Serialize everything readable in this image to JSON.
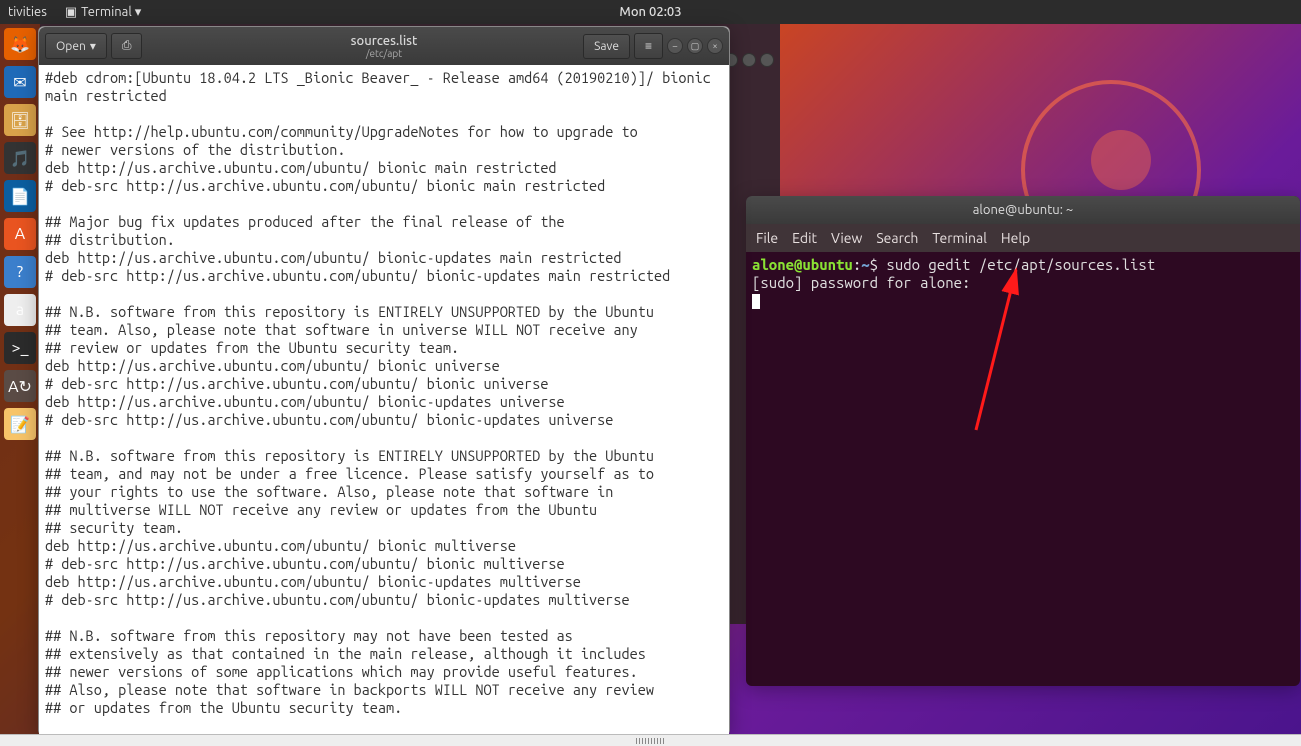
{
  "top_panel": {
    "activities": "tivities",
    "app_menu": "Terminal ▾",
    "clock": "Mon 02:03"
  },
  "launcher": {
    "items": [
      {
        "name": "firefox-icon",
        "bg": "#e66000",
        "glyph": "🦊"
      },
      {
        "name": "thunderbird-icon",
        "bg": "#1f6ab8",
        "glyph": "✉"
      },
      {
        "name": "files-icon",
        "bg": "#d9a24a",
        "glyph": "🗄"
      },
      {
        "name": "rhythmbox-icon",
        "bg": "#333",
        "glyph": "🎵"
      },
      {
        "name": "libreoffice-writer-icon",
        "bg": "#0b5ea0",
        "glyph": "📄"
      },
      {
        "name": "software-icon",
        "bg": "#e95420",
        "glyph": "A"
      },
      {
        "name": "help-icon",
        "bg": "#3b7fcc",
        "glyph": "?"
      },
      {
        "name": "amazon-icon",
        "bg": "#eee",
        "glyph": "a"
      },
      {
        "name": "terminal-icon",
        "bg": "#2b2b2b",
        "glyph": ">_"
      },
      {
        "name": "updater-icon",
        "bg": "#5a4b45",
        "glyph": "A↻"
      },
      {
        "name": "notes-icon",
        "bg": "#f7c469",
        "glyph": "📝"
      }
    ]
  },
  "gedit": {
    "open_label": "Open",
    "save_label": "Save",
    "title": "sources.list",
    "subtitle": "/etc/apt",
    "content": "#deb cdrom:[Ubuntu 18.04.2 LTS _Bionic Beaver_ - Release amd64 (20190210)]/ bionic main restricted\n\n# See http://help.ubuntu.com/community/UpgradeNotes for how to upgrade to\n# newer versions of the distribution.\ndeb http://us.archive.ubuntu.com/ubuntu/ bionic main restricted\n# deb-src http://us.archive.ubuntu.com/ubuntu/ bionic main restricted\n\n## Major bug fix updates produced after the final release of the\n## distribution.\ndeb http://us.archive.ubuntu.com/ubuntu/ bionic-updates main restricted\n# deb-src http://us.archive.ubuntu.com/ubuntu/ bionic-updates main restricted\n\n## N.B. software from this repository is ENTIRELY UNSUPPORTED by the Ubuntu\n## team. Also, please note that software in universe WILL NOT receive any\n## review or updates from the Ubuntu security team.\ndeb http://us.archive.ubuntu.com/ubuntu/ bionic universe\n# deb-src http://us.archive.ubuntu.com/ubuntu/ bionic universe\ndeb http://us.archive.ubuntu.com/ubuntu/ bionic-updates universe\n# deb-src http://us.archive.ubuntu.com/ubuntu/ bionic-updates universe\n\n## N.B. software from this repository is ENTIRELY UNSUPPORTED by the Ubuntu\n## team, and may not be under a free licence. Please satisfy yourself as to\n## your rights to use the software. Also, please note that software in\n## multiverse WILL NOT receive any review or updates from the Ubuntu\n## security team.\ndeb http://us.archive.ubuntu.com/ubuntu/ bionic multiverse\n# deb-src http://us.archive.ubuntu.com/ubuntu/ bionic multiverse\ndeb http://us.archive.ubuntu.com/ubuntu/ bionic-updates multiverse\n# deb-src http://us.archive.ubuntu.com/ubuntu/ bionic-updates multiverse\n\n## N.B. software from this repository may not have been tested as\n## extensively as that contained in the main release, although it includes\n## newer versions of some applications which may provide useful features.\n## Also, please note that software in backports WILL NOT receive any review\n## or updates from the Ubuntu security team."
  },
  "terminal": {
    "title": "alone@ubuntu: ~",
    "menu": {
      "file": "File",
      "edit": "Edit",
      "view": "View",
      "search": "Search",
      "terminal": "Terminal",
      "help": "Help"
    },
    "prompt_user": "alone@ubuntu",
    "prompt_sep": ":",
    "prompt_path": "~",
    "prompt_symbol": "$",
    "command": " sudo gedit /etc/apt/sources.list",
    "line2": "[sudo] password for alone: "
  }
}
